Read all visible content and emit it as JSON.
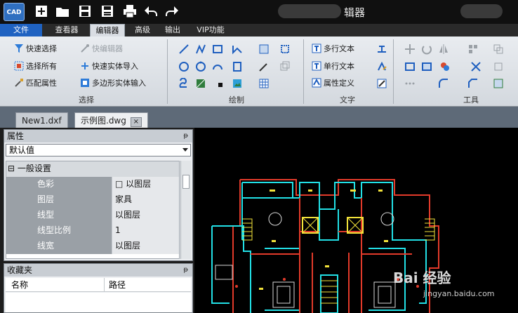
{
  "titlebar": {
    "title": "辑器",
    "logo_text": "CAD",
    "quick_actions": [
      "new-icon",
      "open-icon",
      "save-icon",
      "save-as-icon",
      "print-icon",
      "undo-icon",
      "redo-icon"
    ]
  },
  "menu": {
    "file": "文件",
    "tabs": [
      "查看器",
      "编辑器",
      "高级",
      "输出",
      "VIP功能"
    ],
    "active_tab": "编辑器"
  },
  "ribbon": {
    "select": {
      "quick_select": "快速选择",
      "quick_editor": "快编辑器",
      "select_all": "选择所有",
      "quick_entity_import": "快速实体导入",
      "match_props": "匹配属性",
      "polygon_entity_input": "多边形实体输入",
      "label": "选择"
    },
    "draw": {
      "label": "绘制"
    },
    "text": {
      "mtext": "多行文本",
      "stext": "单行文本",
      "attdef": "属性定义",
      "label": "文字"
    },
    "tools": {
      "label": "工具"
    }
  },
  "doc_tabs": {
    "tab1": "New1.dxf",
    "tab2": "示例图.dwg",
    "close": "×"
  },
  "properties": {
    "title": "属性",
    "pin": "ᵽ",
    "dropdown_value": "默认值",
    "category": "⊟ 一般设置",
    "rows": [
      {
        "key": "色彩",
        "value": "□ 以图层"
      },
      {
        "key": "图层",
        "value": "家具"
      },
      {
        "key": "线型",
        "value": "以图层"
      },
      {
        "key": "线型比例",
        "value": "1"
      },
      {
        "key": "线宽",
        "value": "以图层"
      }
    ]
  },
  "favorites": {
    "title": "收藏夹",
    "pin": "ᵽ",
    "col_name": "名称",
    "col_path": "路径"
  },
  "watermark": {
    "brand": "Bai 经验",
    "url": "jingyan.baidu.com"
  },
  "colors": {
    "accent": "#1f62c1",
    "cad_cyan": "#22e0e6",
    "cad_red": "#e23a2a",
    "cad_yellow": "#f2e23a"
  }
}
